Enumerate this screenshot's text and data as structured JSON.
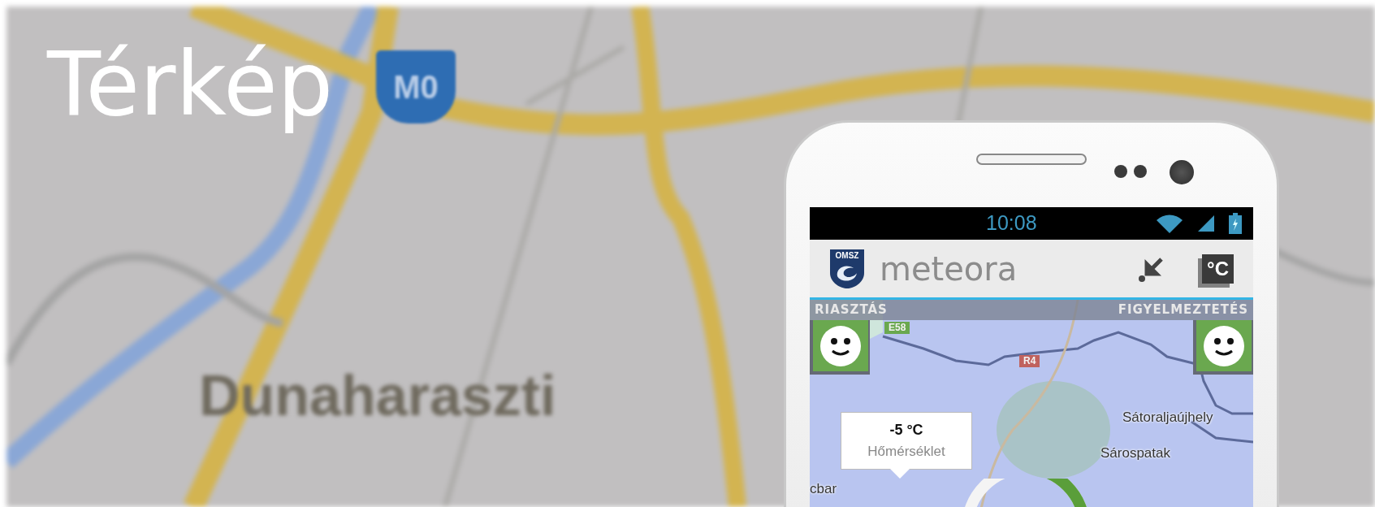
{
  "page": {
    "title": "Térkép"
  },
  "background_map": {
    "labels": [
      {
        "text": "M0",
        "kind": "shield"
      },
      {
        "text": "Dunaharaszti",
        "kind": "place"
      }
    ]
  },
  "phone": {
    "status_bar": {
      "time": "10:08"
    },
    "app_bar": {
      "logo_text": "OMSZ",
      "app_name": "meteora",
      "unit_button": "°C"
    },
    "alerts": {
      "left_label": "RIASZTÁS",
      "right_label": "FIGYELMEZTETÉS"
    },
    "map": {
      "labels": [
        {
          "text": "E58",
          "kind": "shield",
          "color": "#6aa84f"
        },
        {
          "text": "R4",
          "kind": "shield",
          "color": "#c0625e"
        },
        {
          "text": "Sátoraljaújhely",
          "kind": "place"
        },
        {
          "text": "Sárospatak",
          "kind": "place"
        },
        {
          "text": "cbar",
          "kind": "place"
        }
      ]
    },
    "popup": {
      "value": "-5 °C",
      "label": "Hőmérséklet"
    }
  }
}
